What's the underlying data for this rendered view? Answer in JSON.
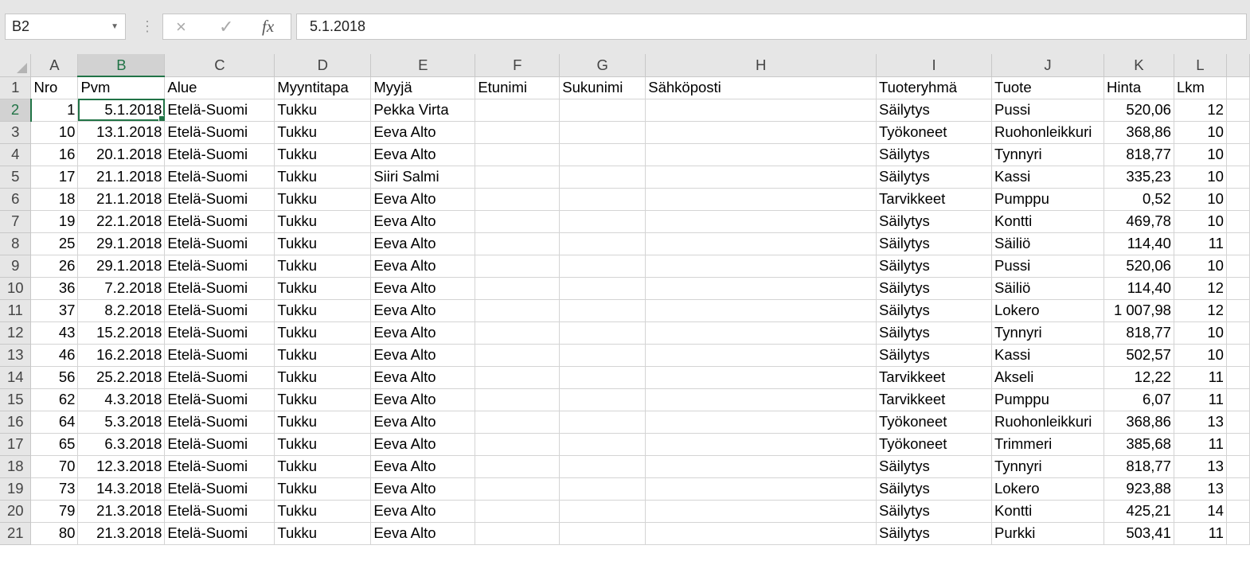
{
  "formula_bar": {
    "name_box": "B2",
    "cancel_icon": "×",
    "enter_icon": "✓",
    "fx_label": "fx",
    "value": "5.1.2018"
  },
  "columns": [
    "A",
    "B",
    "C",
    "D",
    "E",
    "F",
    "G",
    "H",
    "I",
    "J",
    "K",
    "L"
  ],
  "selected_column": "B",
  "selected_row": 2,
  "rows": [
    [
      "Nro",
      "Pvm",
      "Alue",
      "Myyntitapa",
      "Myyjä",
      "Etunimi",
      "Sukunimi",
      "Sähköposti",
      "Tuoteryhmä",
      "Tuote",
      "Hinta",
      "Lkm"
    ],
    [
      "1",
      "5.1.2018",
      "Etelä-Suomi",
      "Tukku",
      "Pekka Virta",
      "",
      "",
      "",
      "Säilytys",
      "Pussi",
      "520,06",
      "12"
    ],
    [
      "10",
      "13.1.2018",
      "Etelä-Suomi",
      "Tukku",
      "Eeva Alto",
      "",
      "",
      "",
      "Työkoneet",
      "Ruohonleikkuri",
      "368,86",
      "10"
    ],
    [
      "16",
      "20.1.2018",
      "Etelä-Suomi",
      "Tukku",
      "Eeva Alto",
      "",
      "",
      "",
      "Säilytys",
      "Tynnyri",
      "818,77",
      "10"
    ],
    [
      "17",
      "21.1.2018",
      "Etelä-Suomi",
      "Tukku",
      "Siiri Salmi",
      "",
      "",
      "",
      "Säilytys",
      "Kassi",
      "335,23",
      "10"
    ],
    [
      "18",
      "21.1.2018",
      "Etelä-Suomi",
      "Tukku",
      "Eeva Alto",
      "",
      "",
      "",
      "Tarvikkeet",
      "Pumppu",
      "0,52",
      "10"
    ],
    [
      "19",
      "22.1.2018",
      "Etelä-Suomi",
      "Tukku",
      "Eeva Alto",
      "",
      "",
      "",
      "Säilytys",
      "Kontti",
      "469,78",
      "10"
    ],
    [
      "25",
      "29.1.2018",
      "Etelä-Suomi",
      "Tukku",
      "Eeva Alto",
      "",
      "",
      "",
      "Säilytys",
      "Säiliö",
      "114,40",
      "11"
    ],
    [
      "26",
      "29.1.2018",
      "Etelä-Suomi",
      "Tukku",
      "Eeva Alto",
      "",
      "",
      "",
      "Säilytys",
      "Pussi",
      "520,06",
      "10"
    ],
    [
      "36",
      "7.2.2018",
      "Etelä-Suomi",
      "Tukku",
      "Eeva Alto",
      "",
      "",
      "",
      "Säilytys",
      "Säiliö",
      "114,40",
      "12"
    ],
    [
      "37",
      "8.2.2018",
      "Etelä-Suomi",
      "Tukku",
      "Eeva Alto",
      "",
      "",
      "",
      "Säilytys",
      "Lokero",
      "1 007,98",
      "12"
    ],
    [
      "43",
      "15.2.2018",
      "Etelä-Suomi",
      "Tukku",
      "Eeva Alto",
      "",
      "",
      "",
      "Säilytys",
      "Tynnyri",
      "818,77",
      "10"
    ],
    [
      "46",
      "16.2.2018",
      "Etelä-Suomi",
      "Tukku",
      "Eeva Alto",
      "",
      "",
      "",
      "Säilytys",
      "Kassi",
      "502,57",
      "10"
    ],
    [
      "56",
      "25.2.2018",
      "Etelä-Suomi",
      "Tukku",
      "Eeva Alto",
      "",
      "",
      "",
      "Tarvikkeet",
      "Akseli",
      "12,22",
      "11"
    ],
    [
      "62",
      "4.3.2018",
      "Etelä-Suomi",
      "Tukku",
      "Eeva Alto",
      "",
      "",
      "",
      "Tarvikkeet",
      "Pumppu",
      "6,07",
      "11"
    ],
    [
      "64",
      "5.3.2018",
      "Etelä-Suomi",
      "Tukku",
      "Eeva Alto",
      "",
      "",
      "",
      "Työkoneet",
      "Ruohonleikkuri",
      "368,86",
      "13"
    ],
    [
      "65",
      "6.3.2018",
      "Etelä-Suomi",
      "Tukku",
      "Eeva Alto",
      "",
      "",
      "",
      "Työkoneet",
      "Trimmeri",
      "385,68",
      "11"
    ],
    [
      "70",
      "12.3.2018",
      "Etelä-Suomi",
      "Tukku",
      "Eeva Alto",
      "",
      "",
      "",
      "Säilytys",
      "Tynnyri",
      "818,77",
      "13"
    ],
    [
      "73",
      "14.3.2018",
      "Etelä-Suomi",
      "Tukku",
      "Eeva Alto",
      "",
      "",
      "",
      "Säilytys",
      "Lokero",
      "923,88",
      "13"
    ],
    [
      "79",
      "21.3.2018",
      "Etelä-Suomi",
      "Tukku",
      "Eeva Alto",
      "",
      "",
      "",
      "Säilytys",
      "Kontti",
      "425,21",
      "14"
    ],
    [
      "80",
      "21.3.2018",
      "Etelä-Suomi",
      "Tukku",
      "Eeva Alto",
      "",
      "",
      "",
      "Säilytys",
      "Purkki",
      "503,41",
      "11"
    ]
  ],
  "colors": {
    "accent": "#217346",
    "header_bg": "#e6e6e6",
    "gridline": "#d4d4d4"
  }
}
